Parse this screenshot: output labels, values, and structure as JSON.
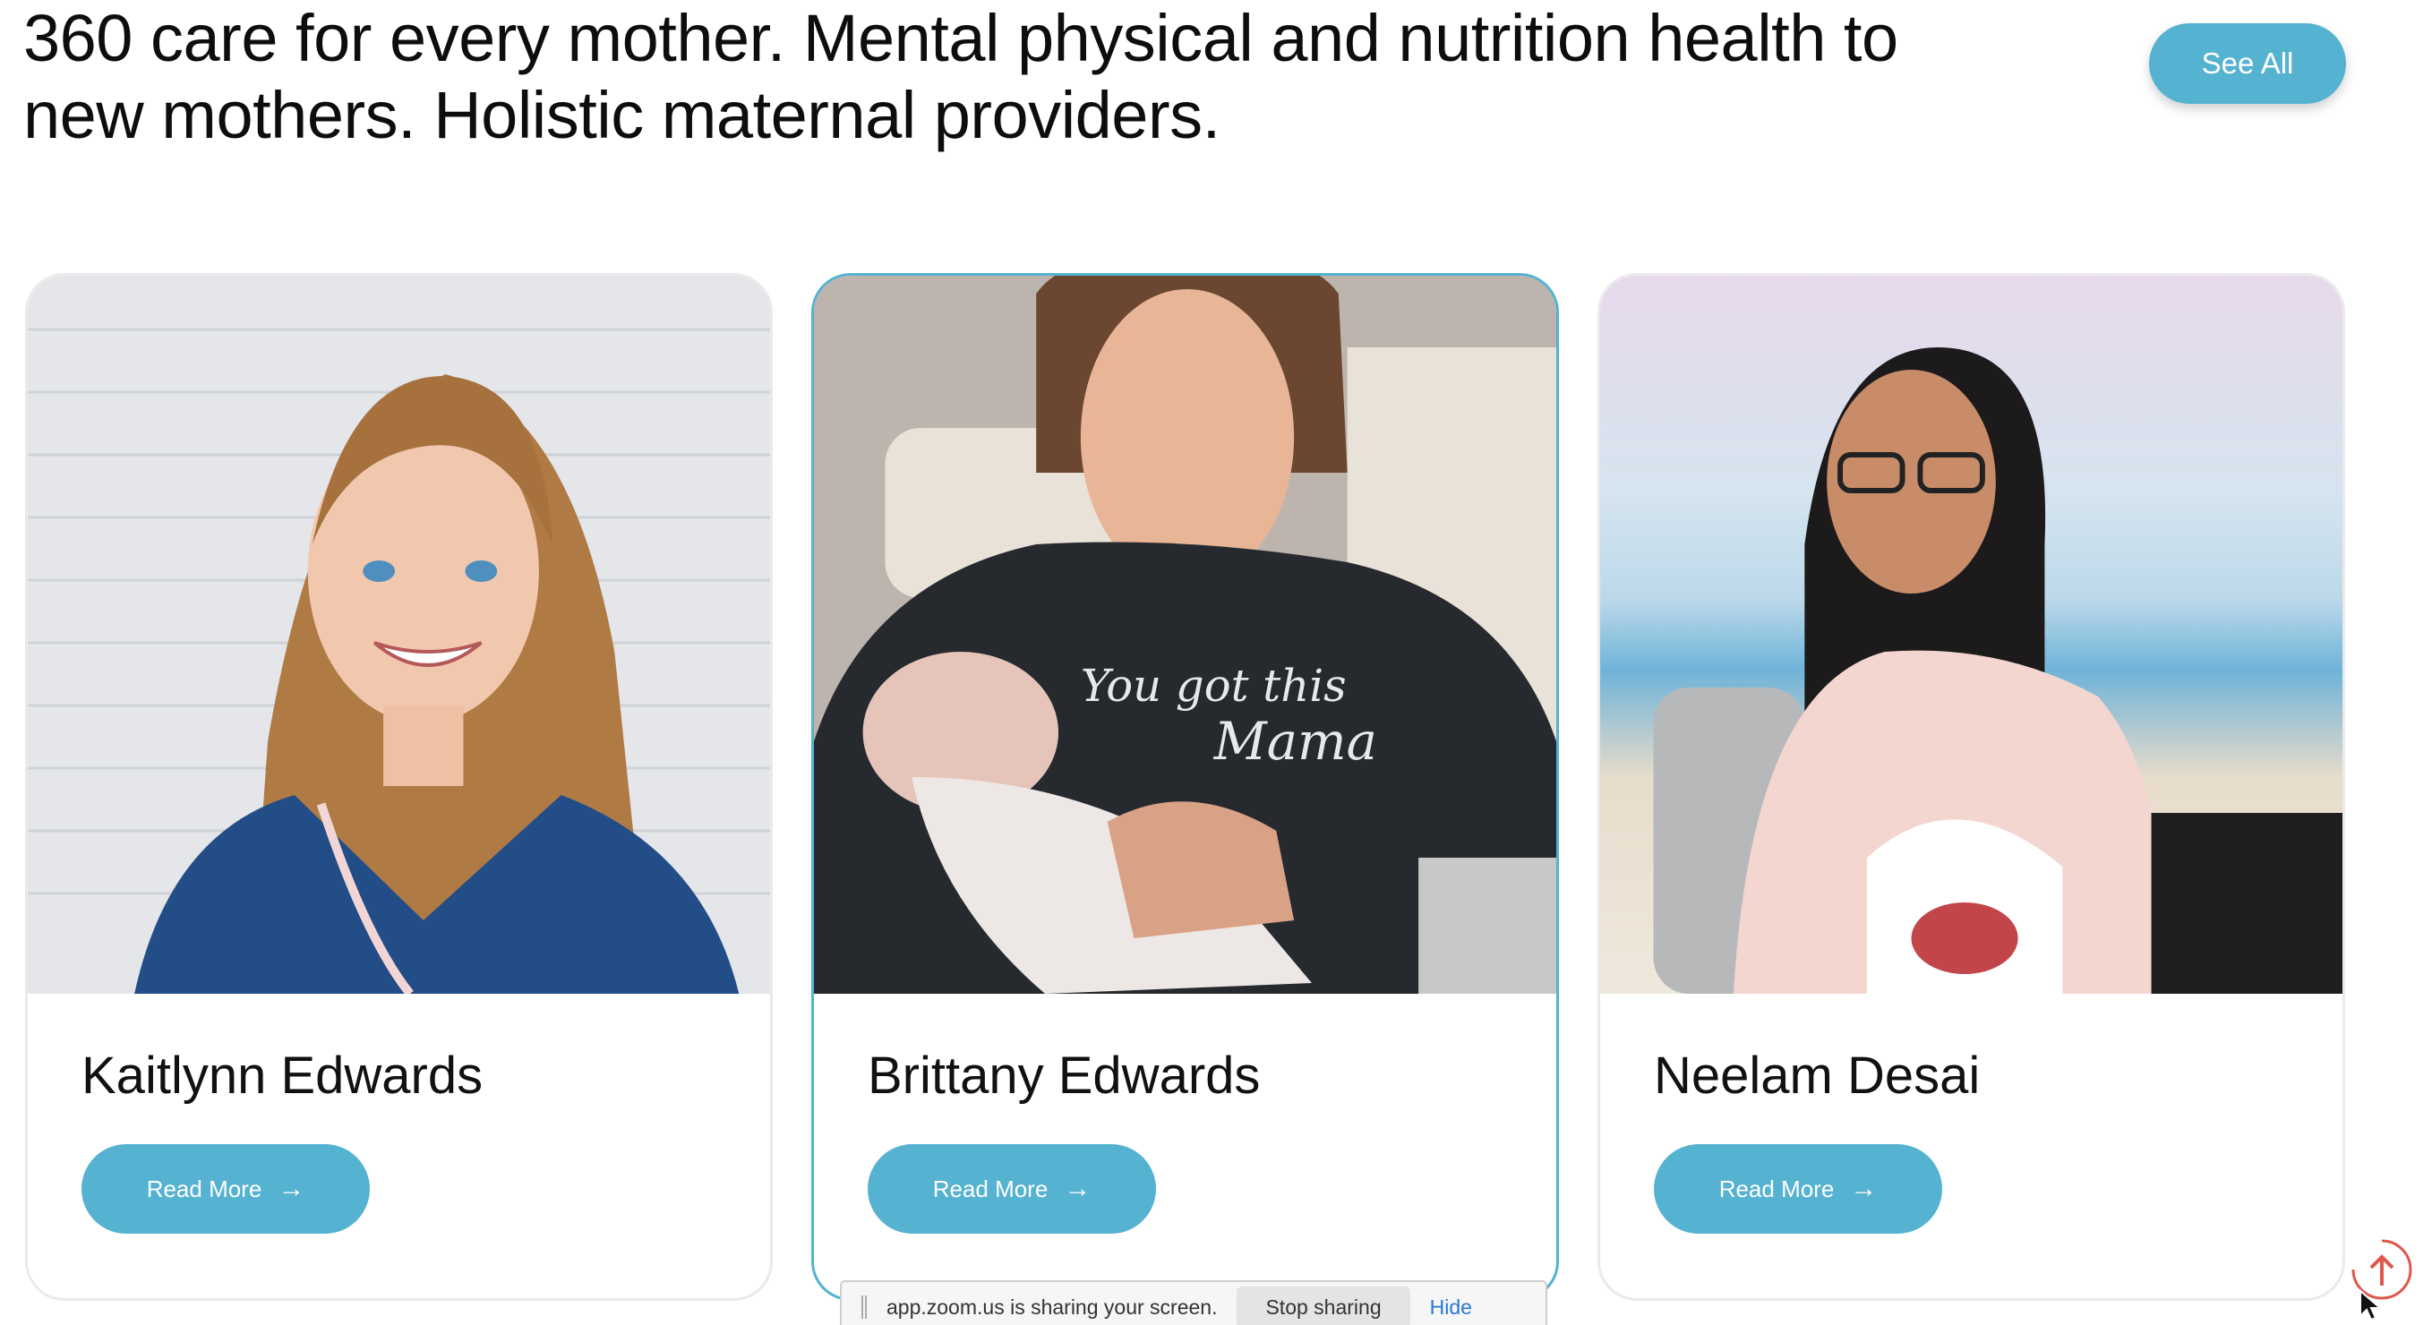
{
  "header": {
    "headline": "360 care for every mother. Mental physical and nutrition health to new mothers. Holistic maternal providers.",
    "see_all_label": "See All"
  },
  "providers": [
    {
      "name": "Kaitlynn Edwards",
      "read_more": "Read More"
    },
    {
      "name": "Brittany Edwards",
      "read_more": "Read More"
    },
    {
      "name": "Neelam Desai",
      "read_more": "Read More"
    }
  ],
  "sweatshirt_text": [
    "You got this",
    "Mama"
  ],
  "zoom_notice": {
    "message": "app.zoom.us is sharing your screen.",
    "stop_label": "Stop sharing",
    "hide_label": "Hide"
  },
  "colors": {
    "accent": "#55b2d0",
    "scroll_top": "#e0574c"
  },
  "icons": {
    "arrow": "arrow-right-icon",
    "scroll_top": "arrow-up-icon"
  }
}
